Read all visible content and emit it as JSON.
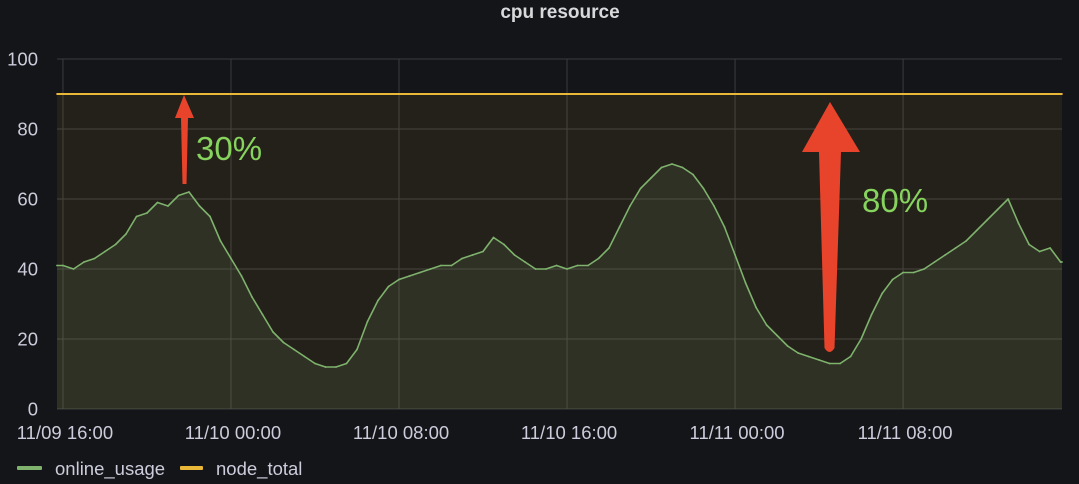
{
  "colors": {
    "background": "#141518",
    "grid": "#3a3b40",
    "axis_text": "#ccccdc",
    "title_text": "#d8d9da",
    "annotation_arrow": "#e8442c",
    "annotation_text": "#86d35e"
  },
  "chart_data": {
    "type": "line",
    "title": "cpu resource",
    "xlim": [
      "11/09 15:43",
      "11/11 15:34"
    ],
    "ylim": [
      0,
      100
    ],
    "x_ticks": [
      "11/09 16:00",
      "11/10 00:00",
      "11/10 08:00",
      "11/10 16:00",
      "11/11 00:00",
      "11/11 08:00"
    ],
    "y_ticks": [
      0,
      20,
      40,
      60,
      80,
      100
    ],
    "grid": true,
    "legend_position": "bottom-left",
    "series": [
      {
        "name": "online_usage",
        "color": "#7EB26D",
        "fill": true,
        "points": [
          [
            "11/09 15:43",
            41
          ],
          [
            "11/09 16:00",
            41
          ],
          [
            "11/09 16:30",
            40
          ],
          [
            "11/09 17:00",
            42
          ],
          [
            "11/09 17:30",
            43
          ],
          [
            "11/09 18:00",
            45
          ],
          [
            "11/09 18:30",
            47
          ],
          [
            "11/09 19:00",
            50
          ],
          [
            "11/09 19:30",
            55
          ],
          [
            "11/09 20:00",
            56
          ],
          [
            "11/09 20:30",
            59
          ],
          [
            "11/09 21:00",
            58
          ],
          [
            "11/09 21:30",
            61
          ],
          [
            "11/09 22:00",
            62
          ],
          [
            "11/09 22:30",
            58
          ],
          [
            "11/09 23:00",
            55
          ],
          [
            "11/09 23:30",
            48
          ],
          [
            "11/10 00:00",
            43
          ],
          [
            "11/10 00:30",
            38
          ],
          [
            "11/10 01:00",
            32
          ],
          [
            "11/10 01:30",
            27
          ],
          [
            "11/10 02:00",
            22
          ],
          [
            "11/10 02:30",
            19
          ],
          [
            "11/10 03:00",
            17
          ],
          [
            "11/10 03:30",
            15
          ],
          [
            "11/10 04:00",
            13
          ],
          [
            "11/10 04:30",
            12
          ],
          [
            "11/10 05:00",
            12
          ],
          [
            "11/10 05:30",
            13
          ],
          [
            "11/10 06:00",
            17
          ],
          [
            "11/10 06:30",
            25
          ],
          [
            "11/10 07:00",
            31
          ],
          [
            "11/10 07:30",
            35
          ],
          [
            "11/10 08:00",
            37
          ],
          [
            "11/10 08:30",
            38
          ],
          [
            "11/10 09:00",
            39
          ],
          [
            "11/10 09:30",
            40
          ],
          [
            "11/10 10:00",
            41
          ],
          [
            "11/10 10:30",
            41
          ],
          [
            "11/10 11:00",
            43
          ],
          [
            "11/10 11:30",
            44
          ],
          [
            "11/10 12:00",
            45
          ],
          [
            "11/10 12:30",
            49
          ],
          [
            "11/10 13:00",
            47
          ],
          [
            "11/10 13:30",
            44
          ],
          [
            "11/10 14:00",
            42
          ],
          [
            "11/10 14:30",
            40
          ],
          [
            "11/10 15:00",
            40
          ],
          [
            "11/10 15:30",
            41
          ],
          [
            "11/10 16:00",
            40
          ],
          [
            "11/10 16:30",
            41
          ],
          [
            "11/10 17:00",
            41
          ],
          [
            "11/10 17:30",
            43
          ],
          [
            "11/10 18:00",
            46
          ],
          [
            "11/10 18:30",
            52
          ],
          [
            "11/10 19:00",
            58
          ],
          [
            "11/10 19:30",
            63
          ],
          [
            "11/10 20:00",
            66
          ],
          [
            "11/10 20:30",
            69
          ],
          [
            "11/10 21:00",
            70
          ],
          [
            "11/10 21:30",
            69
          ],
          [
            "11/10 22:00",
            67
          ],
          [
            "11/10 22:30",
            63
          ],
          [
            "11/10 23:00",
            58
          ],
          [
            "11/10 23:30",
            52
          ],
          [
            "11/11 00:00",
            44
          ],
          [
            "11/11 00:30",
            36
          ],
          [
            "11/11 01:00",
            29
          ],
          [
            "11/11 01:30",
            24
          ],
          [
            "11/11 02:00",
            21
          ],
          [
            "11/11 02:30",
            18
          ],
          [
            "11/11 03:00",
            16
          ],
          [
            "11/11 03:30",
            15
          ],
          [
            "11/11 04:00",
            14
          ],
          [
            "11/11 04:30",
            13
          ],
          [
            "11/11 05:00",
            13
          ],
          [
            "11/11 05:30",
            15
          ],
          [
            "11/11 06:00",
            20
          ],
          [
            "11/11 06:30",
            27
          ],
          [
            "11/11 07:00",
            33
          ],
          [
            "11/11 07:30",
            37
          ],
          [
            "11/11 08:00",
            39
          ],
          [
            "11/11 08:30",
            39
          ],
          [
            "11/11 09:00",
            40
          ],
          [
            "11/11 09:30",
            42
          ],
          [
            "11/11 10:00",
            44
          ],
          [
            "11/11 10:30",
            46
          ],
          [
            "11/11 11:00",
            48
          ],
          [
            "11/11 11:30",
            51
          ],
          [
            "11/11 12:00",
            54
          ],
          [
            "11/11 12:30",
            57
          ],
          [
            "11/11 13:00",
            60
          ],
          [
            "11/11 13:30",
            53
          ],
          [
            "11/11 14:00",
            47
          ],
          [
            "11/11 14:30",
            45
          ],
          [
            "11/11 15:00",
            46
          ],
          [
            "11/11 15:30",
            42
          ],
          [
            "11/11 15:34",
            42
          ]
        ]
      },
      {
        "name": "node_total",
        "color": "#EAB839",
        "fill": true,
        "points": [
          [
            "11/09 15:43",
            90
          ],
          [
            "11/11 15:34",
            90
          ]
        ]
      }
    ],
    "annotations": [
      {
        "text": "30%"
      },
      {
        "text": "80%"
      }
    ]
  }
}
